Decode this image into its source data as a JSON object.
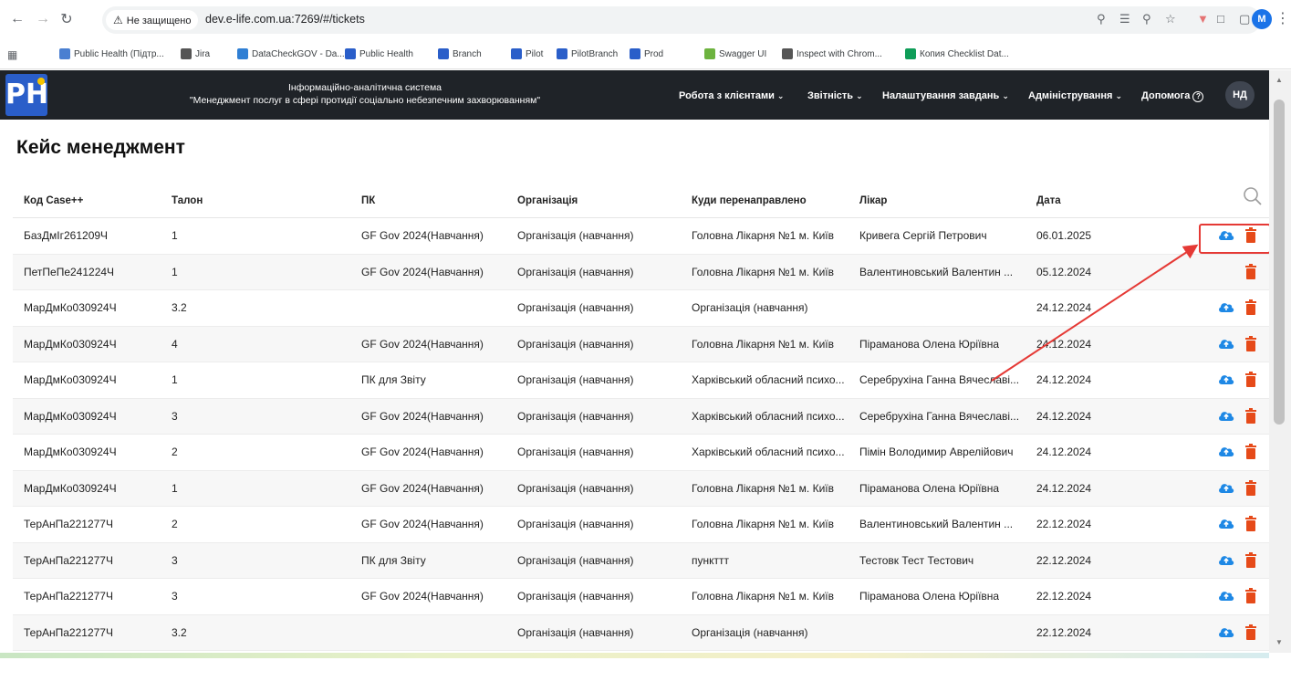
{
  "browser": {
    "security_label": "Не защищено",
    "url": "dev.e-life.com.ua:7269/#/tickets",
    "profile_initial": "M",
    "bookmarks": [
      {
        "label": "Public Health (Підтр...",
        "icon": "public-health-icon",
        "color": "#4a7fd1"
      },
      {
        "label": "Jira",
        "icon": "globe-icon",
        "color": "#555555"
      },
      {
        "label": "DataCheckGOV - Da...",
        "icon": "butterfly-icon",
        "color": "#2f7fd4"
      },
      {
        "label": "Public Health",
        "icon": "ph-icon",
        "color": "#2a5ec9"
      },
      {
        "label": "Branch",
        "icon": "ph-icon",
        "color": "#2a5ec9"
      },
      {
        "label": "Pilot",
        "icon": "ph-icon",
        "color": "#2a5ec9"
      },
      {
        "label": "PilotBranch",
        "icon": "ph-icon",
        "color": "#2a5ec9"
      },
      {
        "label": "Prod",
        "icon": "ph-icon",
        "color": "#2a5ec9"
      },
      {
        "label": "Swagger UI",
        "icon": "swagger-icon",
        "color": "#6db33f"
      },
      {
        "label": "Inspect with Chrom...",
        "icon": "globe-icon",
        "color": "#555555"
      },
      {
        "label": "Копия Checklist Dat...",
        "icon": "sheets-icon",
        "color": "#0f9d58"
      }
    ]
  },
  "app": {
    "logo_text": "PH",
    "system_title_line1": "Інформаційно-аналітична система",
    "system_title_line2": "\"Менеджмент послуг в сфері протидії соціально небезпечним захворюванням\"",
    "menu": [
      {
        "label": "Робота з клієнтами",
        "has_chevron": true
      },
      {
        "label": "Звітність",
        "has_chevron": true
      },
      {
        "label": "Налаштування завдань",
        "has_chevron": true
      },
      {
        "label": "Адміністрування",
        "has_chevron": true
      },
      {
        "label": "Допомога",
        "has_chevron": false
      }
    ],
    "user_initials": "НД"
  },
  "page": {
    "title": "Кейс менеджмент",
    "columns": [
      "Код Case++",
      "Талон",
      "ПК",
      "Організація",
      "Куди перенаправлено",
      "Лікар",
      "Дата"
    ],
    "rows": [
      {
        "code": "БазДмІг261209Ч",
        "talon": "1",
        "pk": "GF Gov 2024(Навчання)",
        "org": "Організація (навчання)",
        "redirect": "Головна Лікарня №1 м. Київ",
        "doctor": "Кривега Сергій Петрович",
        "date": "06.01.2025",
        "cloud": true,
        "trash": true
      },
      {
        "code": "ПетПеПе241224Ч",
        "talon": "1",
        "pk": "GF Gov 2024(Навчання)",
        "org": "Організація (навчання)",
        "redirect": "Головна Лікарня №1 м. Київ",
        "doctor": "Валентиновський Валентин ...",
        "date": "05.12.2024",
        "cloud": false,
        "trash": true
      },
      {
        "code": "МарДмКо030924Ч",
        "talon": "3.2",
        "pk": "",
        "org": "Організація (навчання)",
        "redirect": "Організація (навчання)",
        "doctor": "",
        "date": "24.12.2024",
        "cloud": true,
        "trash": true
      },
      {
        "code": "МарДмКо030924Ч",
        "talon": "4",
        "pk": "GF Gov 2024(Навчання)",
        "org": "Організація (навчання)",
        "redirect": "Головна Лікарня №1 м. Київ",
        "doctor": "Піраманова Олена Юріївна",
        "date": "24.12.2024",
        "cloud": true,
        "trash": true
      },
      {
        "code": "МарДмКо030924Ч",
        "talon": "1",
        "pk": "ПК для Звіту",
        "org": "Організація (навчання)",
        "redirect": "Харківський обласний психо...",
        "doctor": "Серебрухіна Ганна Вячеславі...",
        "date": "24.12.2024",
        "cloud": true,
        "trash": true
      },
      {
        "code": "МарДмКо030924Ч",
        "talon": "3",
        "pk": "GF Gov 2024(Навчання)",
        "org": "Організація (навчання)",
        "redirect": "Харківський обласний психо...",
        "doctor": "Серебрухіна Ганна Вячеславі...",
        "date": "24.12.2024",
        "cloud": true,
        "trash": true
      },
      {
        "code": "МарДмКо030924Ч",
        "talon": "2",
        "pk": "GF Gov 2024(Навчання)",
        "org": "Організація (навчання)",
        "redirect": "Харківський обласний психо...",
        "doctor": "Пімін Володимир Аврелійович",
        "date": "24.12.2024",
        "cloud": true,
        "trash": true
      },
      {
        "code": "МарДмКо030924Ч",
        "talon": "1",
        "pk": "GF Gov 2024(Навчання)",
        "org": "Організація (навчання)",
        "redirect": "Головна Лікарня №1 м. Київ",
        "doctor": "Піраманова Олена Юріївна",
        "date": "24.12.2024",
        "cloud": true,
        "trash": true
      },
      {
        "code": "ТерАнПа221277Ч",
        "talon": "2",
        "pk": "GF Gov 2024(Навчання)",
        "org": "Організація (навчання)",
        "redirect": "Головна Лікарня №1 м. Київ",
        "doctor": "Валентиновський Валентин ...",
        "date": "22.12.2024",
        "cloud": true,
        "trash": true
      },
      {
        "code": "ТерАнПа221277Ч",
        "talon": "3",
        "pk": "ПК для Звіту",
        "org": "Організація (навчання)",
        "redirect": "пункттт",
        "doctor": "Тестовк Тест Тестович",
        "date": "22.12.2024",
        "cloud": true,
        "trash": true
      },
      {
        "code": "ТерАнПа221277Ч",
        "talon": "3",
        "pk": "GF Gov 2024(Навчання)",
        "org": "Організація (навчання)",
        "redirect": "Головна Лікарня №1 м. Київ",
        "doctor": "Піраманова Олена Юріївна",
        "date": "22.12.2024",
        "cloud": true,
        "trash": true
      },
      {
        "code": "ТерАнПа221277Ч",
        "talon": "3.2",
        "pk": "",
        "org": "Організація (навчання)",
        "redirect": "Організація (навчання)",
        "doctor": "",
        "date": "22.12.2024",
        "cloud": true,
        "trash": true
      }
    ]
  },
  "colors": {
    "header_bg": "#1f2328",
    "cloud_icon": "#1e88e5",
    "trash_icon": "#e64a19",
    "annotation_red": "#e53935"
  }
}
